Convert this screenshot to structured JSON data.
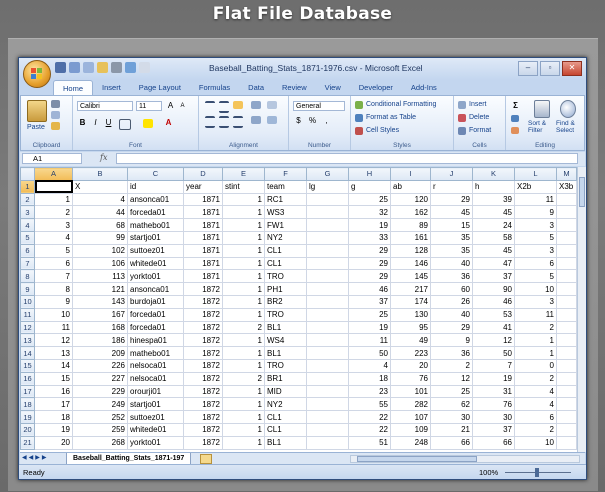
{
  "page": {
    "title": "Flat File Database"
  },
  "window": {
    "title": "Baseball_Batting_Stats_1871-1976.csv - Microsoft Excel"
  },
  "ribbon": {
    "tabs": [
      "Home",
      "Insert",
      "Page Layout",
      "Formulas",
      "Data",
      "Review",
      "View",
      "Developer",
      "Add-Ins"
    ],
    "clipboard": {
      "paste": "Paste",
      "label": "Clipboard"
    },
    "font": {
      "name": "Calibri",
      "size": "11",
      "label": "Font"
    },
    "alignment": {
      "label": "Alignment"
    },
    "number": {
      "format": "General",
      "label": "Number"
    },
    "styles": {
      "conditional": "Conditional Formatting",
      "format_table": "Format as Table",
      "cell_styles": "Cell Styles",
      "label": "Styles"
    },
    "cells": {
      "insert": "Insert",
      "delete": "Delete",
      "format": "Format",
      "label": "Cells"
    },
    "editing": {
      "sort": "Sort & Filter",
      "find": "Find & Select",
      "label": "Editing"
    }
  },
  "formula_bar": {
    "name_box": "A1",
    "fx": "fx",
    "value": ""
  },
  "sheet": {
    "col_letters": [
      "A",
      "B",
      "C",
      "D",
      "E",
      "F",
      "G",
      "H",
      "I",
      "J",
      "K",
      "L",
      "M"
    ],
    "row_numbers": [
      "1",
      "2",
      "3",
      "4",
      "5",
      "6",
      "7",
      "8",
      "9",
      "10",
      "11",
      "12",
      "13",
      "14",
      "15",
      "16",
      "17",
      "18",
      "19",
      "20",
      "21"
    ],
    "header_row": [
      "",
      "X",
      "id",
      "year",
      "stint",
      "team",
      "lg",
      "g",
      "ab",
      "r",
      "h",
      "X2b",
      "X3b"
    ],
    "rows": [
      [
        "1",
        "4",
        "ansonca01",
        "1871",
        "1",
        "RC1",
        "",
        "25",
        "120",
        "29",
        "39",
        "11",
        ""
      ],
      [
        "2",
        "44",
        "forceda01",
        "1871",
        "1",
        "WS3",
        "",
        "32",
        "162",
        "45",
        "45",
        "9",
        ""
      ],
      [
        "3",
        "68",
        "mathebo01",
        "1871",
        "1",
        "FW1",
        "",
        "19",
        "89",
        "15",
        "24",
        "3",
        ""
      ],
      [
        "4",
        "99",
        "startjo01",
        "1871",
        "1",
        "NY2",
        "",
        "33",
        "161",
        "35",
        "58",
        "5",
        ""
      ],
      [
        "5",
        "102",
        "suttoez01",
        "1871",
        "1",
        "CL1",
        "",
        "29",
        "128",
        "35",
        "45",
        "3",
        ""
      ],
      [
        "6",
        "106",
        "whitede01",
        "1871",
        "1",
        "CL1",
        "",
        "29",
        "146",
        "40",
        "47",
        "6",
        ""
      ],
      [
        "7",
        "113",
        "yorkto01",
        "1871",
        "1",
        "TRO",
        "",
        "29",
        "145",
        "36",
        "37",
        "5",
        ""
      ],
      [
        "8",
        "121",
        "ansonca01",
        "1872",
        "1",
        "PH1",
        "",
        "46",
        "217",
        "60",
        "90",
        "10",
        ""
      ],
      [
        "9",
        "143",
        "burdoja01",
        "1872",
        "1",
        "BR2",
        "",
        "37",
        "174",
        "26",
        "46",
        "3",
        ""
      ],
      [
        "10",
        "167",
        "forceda01",
        "1872",
        "1",
        "TRO",
        "",
        "25",
        "130",
        "40",
        "53",
        "11",
        ""
      ],
      [
        "11",
        "168",
        "forceda01",
        "1872",
        "2",
        "BL1",
        "",
        "19",
        "95",
        "29",
        "41",
        "2",
        ""
      ],
      [
        "12",
        "186",
        "hinespa01",
        "1872",
        "1",
        "WS4",
        "",
        "11",
        "49",
        "9",
        "12",
        "1",
        ""
      ],
      [
        "13",
        "209",
        "mathebo01",
        "1872",
        "1",
        "BL1",
        "",
        "50",
        "223",
        "36",
        "50",
        "1",
        ""
      ],
      [
        "14",
        "226",
        "nelsoca01",
        "1872",
        "1",
        "TRO",
        "",
        "4",
        "20",
        "2",
        "7",
        "0",
        ""
      ],
      [
        "15",
        "227",
        "nelsoca01",
        "1872",
        "2",
        "BR1",
        "",
        "18",
        "76",
        "12",
        "19",
        "2",
        ""
      ],
      [
        "16",
        "229",
        "orourji01",
        "1872",
        "1",
        "MID",
        "",
        "23",
        "101",
        "25",
        "31",
        "4",
        ""
      ],
      [
        "17",
        "249",
        "startjo01",
        "1872",
        "1",
        "NY2",
        "",
        "55",
        "282",
        "62",
        "76",
        "4",
        ""
      ],
      [
        "18",
        "252",
        "suttoez01",
        "1872",
        "1",
        "CL1",
        "",
        "22",
        "107",
        "30",
        "30",
        "6",
        ""
      ],
      [
        "19",
        "259",
        "whitede01",
        "1872",
        "1",
        "CL1",
        "",
        "22",
        "109",
        "21",
        "37",
        "2",
        ""
      ],
      [
        "20",
        "268",
        "yorkto01",
        "1872",
        "1",
        "BL1",
        "",
        "51",
        "248",
        "66",
        "66",
        "10",
        ""
      ]
    ],
    "tab_name": "Baseball_Batting_Stats_1871-197"
  },
  "status": {
    "ready": "Ready",
    "zoom": "100%"
  },
  "colors": {
    "accent": "#15428b",
    "selected_header": "#f2bc56"
  }
}
